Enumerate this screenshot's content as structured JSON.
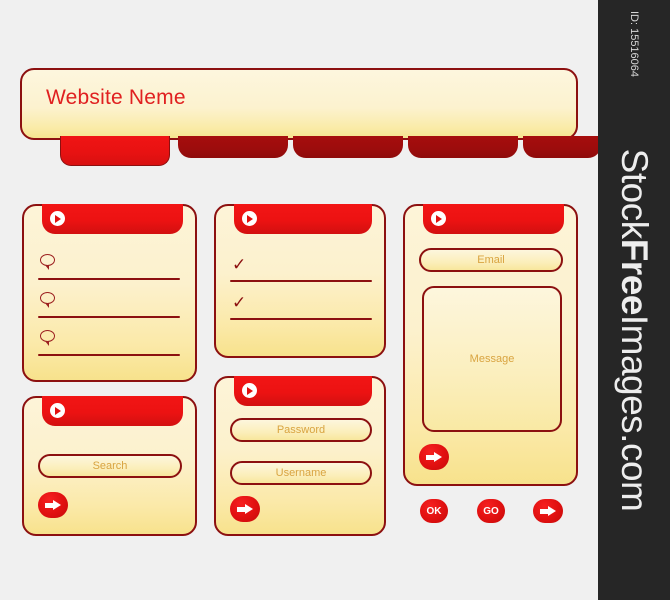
{
  "background_color": "#f0f0f0",
  "accent_color": "#e01010",
  "border_color": "#8c1010",
  "panel_fill_top": "#fdf4d8",
  "panel_fill_bottom": "#f7e28c",
  "placeholder_color": "#d9a441",
  "header": {
    "site_title": "Website Neme"
  },
  "nav": {
    "tabs": [
      {
        "label": "",
        "active": true
      },
      {
        "label": "",
        "active": false
      },
      {
        "label": "",
        "active": false
      },
      {
        "label": "",
        "active": false
      },
      {
        "label": "",
        "active": false
      }
    ]
  },
  "panels": {
    "comments": {
      "name": "comments-panel",
      "head_icon": "play-icon",
      "rows": [
        {
          "icon": "speech-bubble-icon",
          "line": true
        },
        {
          "icon": "speech-bubble-icon",
          "line": true
        },
        {
          "icon": "speech-bubble-icon",
          "line": true
        }
      ]
    },
    "checklist": {
      "name": "checklist-panel",
      "head_icon": "play-icon",
      "rows": [
        {
          "icon": "check-icon",
          "glyph": "✓",
          "line": true
        },
        {
          "icon": "check-icon",
          "glyph": "✓",
          "line": true
        }
      ]
    },
    "contact": {
      "name": "contact-panel",
      "head_icon": "play-icon",
      "email_placeholder": "Email",
      "message_placeholder": "Message",
      "submit_icon": "arrow-right-icon"
    },
    "search": {
      "name": "search-panel",
      "head_icon": "play-icon",
      "search_placeholder": "Search",
      "submit_icon": "arrow-right-icon"
    },
    "login": {
      "name": "login-panel",
      "head_icon": "play-icon",
      "password_placeholder": "Password",
      "username_placeholder": "Username",
      "submit_icon": "arrow-right-icon"
    }
  },
  "action_buttons": [
    {
      "label": "OK",
      "icon": ""
    },
    {
      "label": "GO",
      "icon": ""
    },
    {
      "label": "",
      "icon": "arrow-right-icon"
    }
  ],
  "watermark": {
    "id_text": "ID: 15516064",
    "brand_prefix": "Stock",
    "brand_bold": "Free",
    "brand_suffix": "Images.com"
  }
}
